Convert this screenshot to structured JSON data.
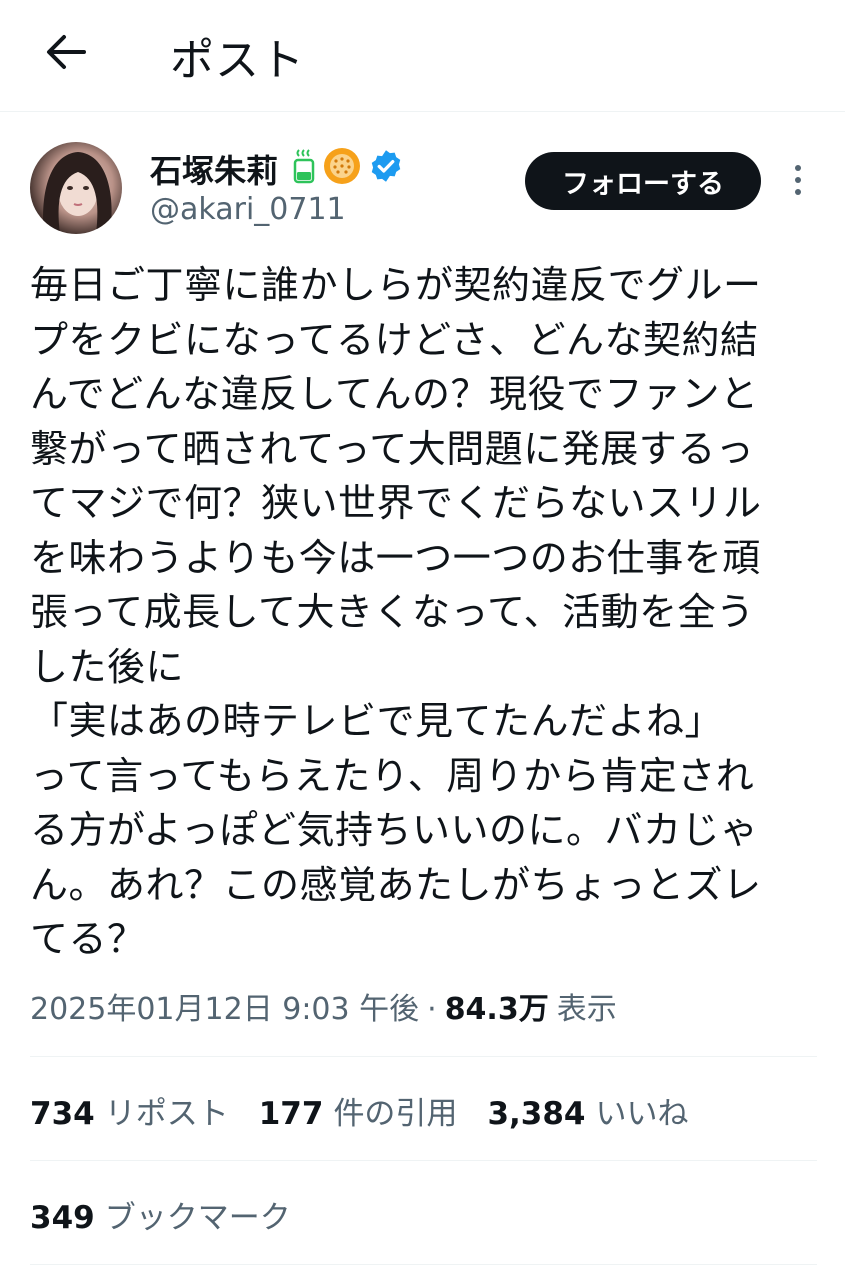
{
  "header": {
    "title": "ポスト"
  },
  "author": {
    "display_name": "石塚朱莉",
    "handle": "@akari_0711"
  },
  "actions": {
    "follow_label": "フォローする"
  },
  "post": {
    "text": "毎日ご丁寧に誰かしらが契約違反でグルー\nプをクビになってるけどさ、どんな契約結\nんでどんな違反してんの？現役でファンと\n繋がって晒されてって大問題に発展するっ\nてマジで何？狭い世界でくだらないスリル\nを味わうよりも今は一つ一つのお仕事を頑\n張って成長して大きくなって、活動を全う\nした後に\n「実はあの時テレビで見てたんだよね」\nって言ってもらえたり、周りから肯定され\nる方がよっぽど気持ちいいのに。バカじゃ\nん。あれ？この感覚あたしがちょっとズレ\nてる？",
    "timestamp": "2025年01月12日 9:03 午後",
    "separator": "·",
    "views_count": "84.3万",
    "views_label": "表示"
  },
  "stats": {
    "reposts": {
      "count": "734",
      "label": "リポスト"
    },
    "quotes": {
      "count": "177",
      "label": "件の引用"
    },
    "likes": {
      "count": "3,384",
      "label": "いいね"
    },
    "bookmarks": {
      "count": "349",
      "label": "ブックマーク"
    }
  },
  "icons": {
    "back": "arrow-left-icon",
    "more": "more-vertical-icon",
    "badges": [
      "green-cup-icon",
      "orange-badge-icon",
      "verified-icon"
    ]
  },
  "colors": {
    "text": "#0f1419",
    "muted": "#536471",
    "verified": "#1d9bf0",
    "follow_bg": "#0f1419",
    "badge_orange": "#f6a11a",
    "badge_green": "#2ec35a"
  }
}
